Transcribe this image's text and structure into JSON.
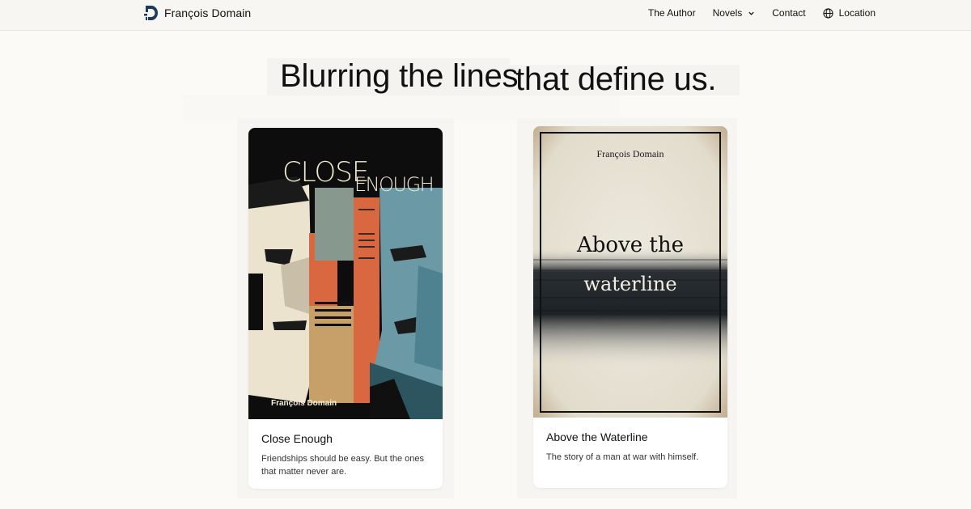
{
  "header": {
    "brand_name": "François Domain",
    "nav": [
      {
        "label": "The Author"
      },
      {
        "label": "Novels"
      },
      {
        "label": "Contact"
      },
      {
        "label": "Location"
      }
    ]
  },
  "hero": {
    "line_left": "Blurring the lines",
    "line_right": "that define us."
  },
  "books": [
    {
      "title": "Close Enough",
      "description": "Friendships should be easy. But the ones that matter never are.",
      "cover_title_a": "CLOSE",
      "cover_title_b": "ENOUGH",
      "cover_author": "François Domain"
    },
    {
      "title": "Above the Waterline",
      "description": "The story of a man at war with himself.",
      "cover_author": "François Domain",
      "cover_title_a": "Above the",
      "cover_title_b": "waterline"
    }
  ],
  "colors": {
    "page_bg": "#fbfaf6",
    "header_bg": "#f7f6f2",
    "logo_blue": "#1f3b5c"
  }
}
